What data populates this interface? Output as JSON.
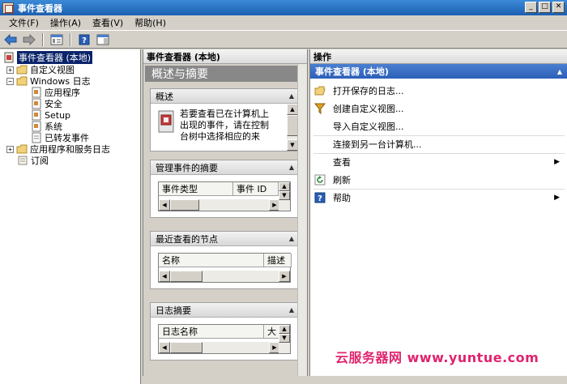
{
  "window": {
    "title": "事件查看器"
  },
  "menubar": [
    "文件(F)",
    "操作(A)",
    "查看(V)",
    "帮助(H)"
  ],
  "toolbar": {
    "icons": [
      "back-arrow-icon",
      "forward-arrow-icon",
      "show-hide-tree-icon",
      "help-icon",
      "show-hide-action-pane-icon"
    ]
  },
  "tree": {
    "root": "事件查看器 (本地)",
    "items": {
      "custom_views": "自定义视图",
      "windows_logs": "Windows 日志",
      "application": "应用程序",
      "security": "安全",
      "setup": "Setup",
      "system": "系统",
      "forwarded": "已转发事件",
      "app_service_logs": "应用程序和服务日志",
      "subscriptions": "订阅"
    }
  },
  "middle": {
    "header": "事件查看器 (本地)",
    "overview_title": "概述与摘要",
    "overview_section": {
      "title": "概述",
      "text_line1": "若要查看已在计算机上",
      "text_line2": "出现的事件，请在控制",
      "text_line3": "台树中选择相应的来"
    },
    "admin_section": {
      "title": "管理事件的摘要",
      "columns": [
        "事件类型",
        "事件 ID"
      ]
    },
    "recent_section": {
      "title": "最近查看的节点",
      "columns": [
        "名称",
        "描述"
      ]
    },
    "log_section": {
      "title": "日志摘要",
      "columns": [
        "日志名称",
        "大"
      ]
    }
  },
  "actions": {
    "header": "操作",
    "subheader": "事件查看器 (本地)",
    "items": {
      "open_saved": "打开保存的日志...",
      "create_view": "创建自定义视图...",
      "import_view": "导入自定义视图...",
      "connect": "连接到另一台计算机...",
      "view": "查看",
      "refresh": "刷新",
      "help": "帮助"
    }
  },
  "watermark": "云服务器网 www.yuntue.com",
  "colors": {
    "titlebar": "#1c5fb1",
    "selection": "#0a246a",
    "action_subheader": "#2c5fb8",
    "watermark": "#e0246f"
  }
}
